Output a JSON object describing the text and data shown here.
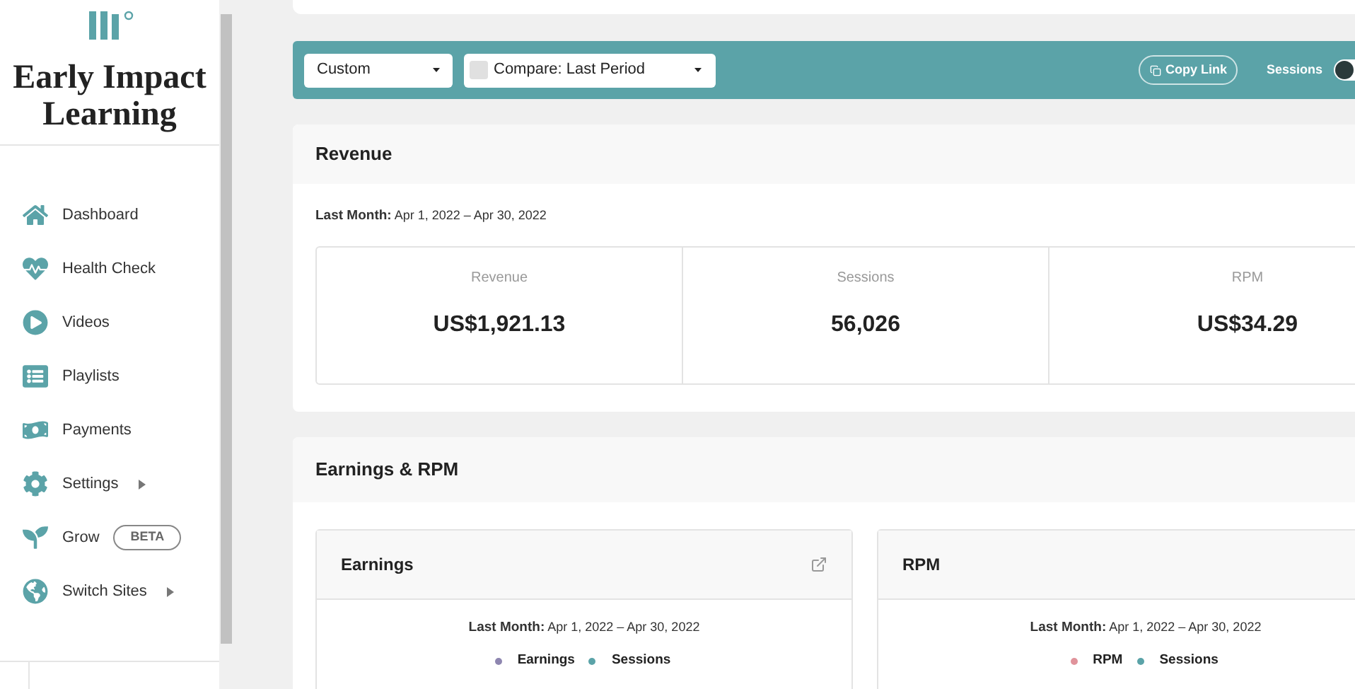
{
  "sidebar": {
    "brand": "Early Impact Learning",
    "items": [
      {
        "label": "Dashboard",
        "has_submenu": false
      },
      {
        "label": "Health Check",
        "has_submenu": false
      },
      {
        "label": "Videos",
        "has_submenu": false
      },
      {
        "label": "Playlists",
        "has_submenu": false
      },
      {
        "label": "Payments",
        "has_submenu": false
      },
      {
        "label": "Settings",
        "has_submenu": true
      },
      {
        "label": "Grow",
        "has_submenu": false,
        "badge": "BETA"
      },
      {
        "label": "Switch Sites",
        "has_submenu": true
      }
    ]
  },
  "toolbar": {
    "range": "Custom",
    "compare": {
      "label": "Compare: Last Period",
      "checked": false
    },
    "copy_link": "Copy Link",
    "sessions_toggle": {
      "label": "Sessions",
      "on": false
    }
  },
  "revenue": {
    "title": "Revenue",
    "period_label": "Last Month:",
    "period": "Apr 1, 2022 – Apr 30, 2022",
    "metrics": [
      {
        "label": "Revenue",
        "value": "US$1,921.13"
      },
      {
        "label": "Sessions",
        "value": "56,026"
      },
      {
        "label": "RPM",
        "value": "US$34.29"
      }
    ]
  },
  "earnings_rpm": {
    "title": "Earnings & RPM",
    "cards": [
      {
        "title": "Earnings",
        "external_link": true,
        "period_label": "Last Month:",
        "period": "Apr 1, 2022 – Apr 30, 2022",
        "legend": [
          {
            "label": "Earnings",
            "color": "#8e86b0"
          },
          {
            "label": "Sessions",
            "color": "#5ba3a8"
          }
        ]
      },
      {
        "title": "RPM",
        "external_link": false,
        "period_label": "Last Month:",
        "period": "Apr 1, 2022 – Apr 30, 2022",
        "legend": [
          {
            "label": "RPM",
            "color": "#e0939b"
          },
          {
            "label": "Sessions",
            "color": "#5ba3a8"
          }
        ]
      }
    ]
  }
}
